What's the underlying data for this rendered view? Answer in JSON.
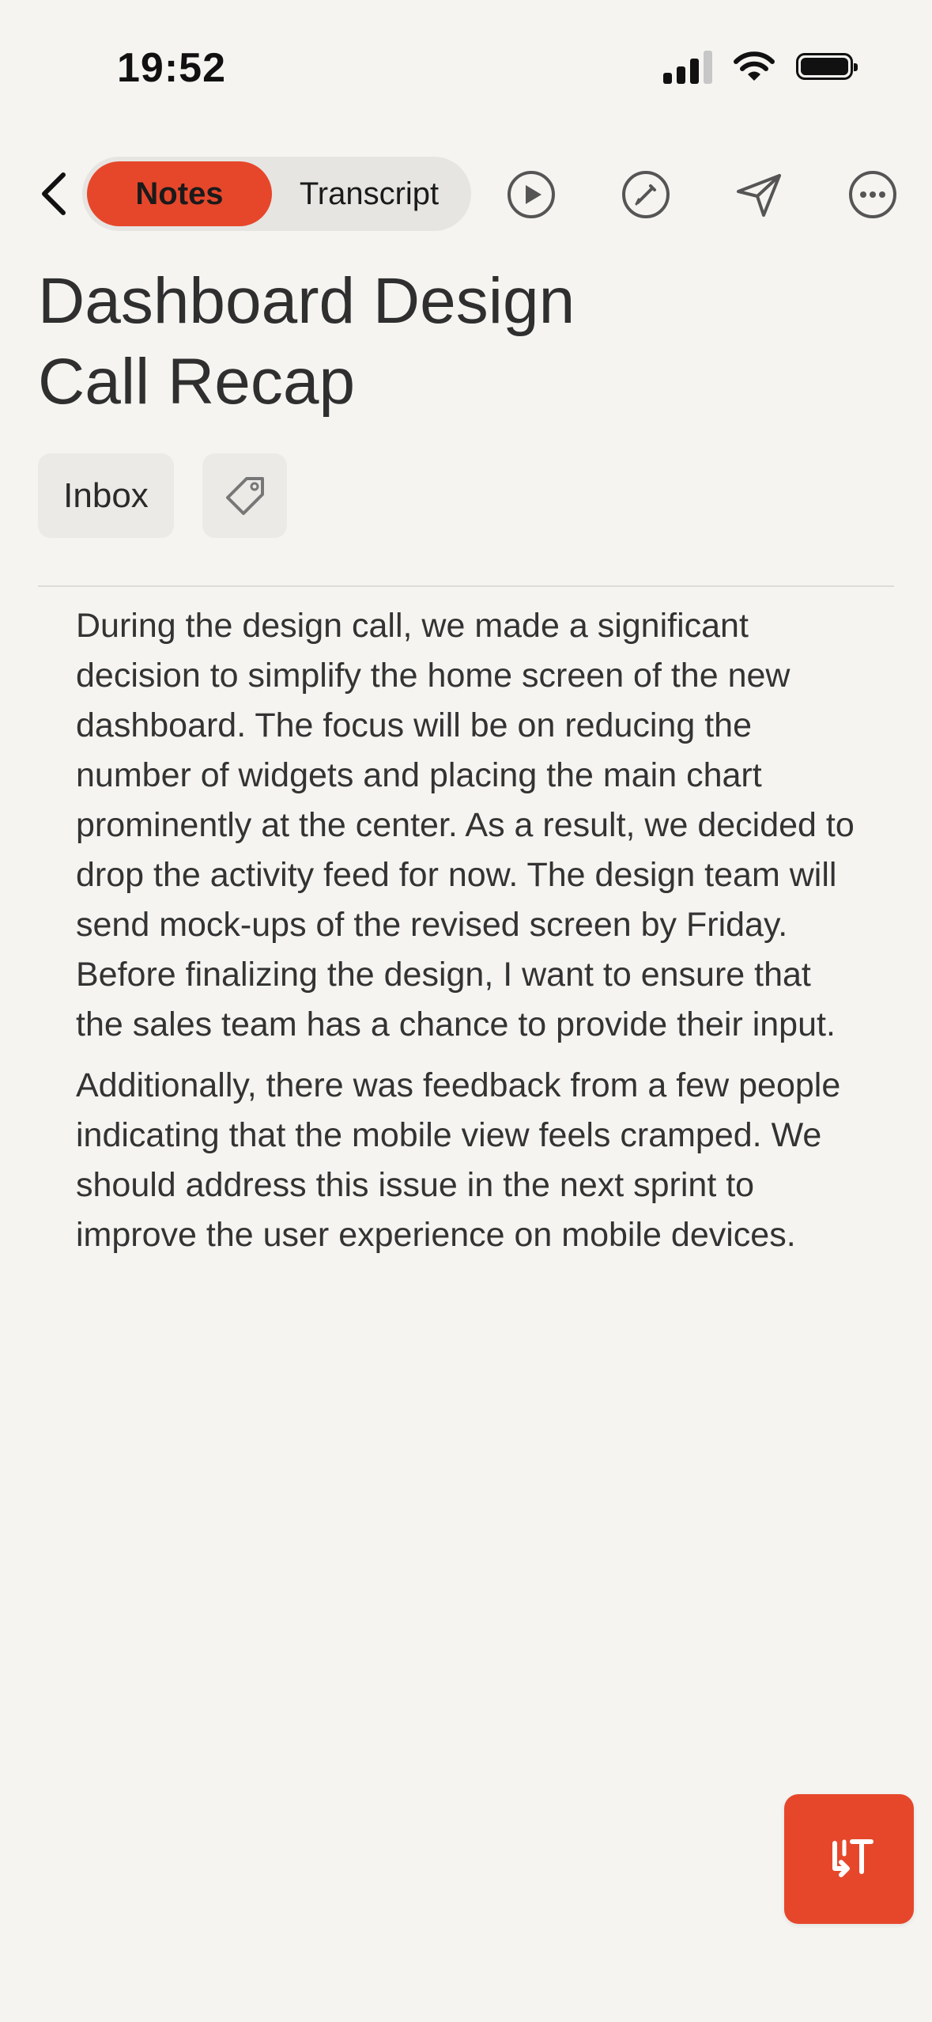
{
  "status_bar": {
    "time": "19:52",
    "icons": [
      "cellular-signal-icon",
      "wifi-icon",
      "battery-icon"
    ]
  },
  "toolbar": {
    "back_icon": "chevron-left-icon",
    "tabs": [
      {
        "label": "Notes",
        "active": true
      },
      {
        "label": "Transcript",
        "active": false
      }
    ],
    "actions": [
      "play-icon",
      "edit-icon",
      "send-icon",
      "more-icon"
    ]
  },
  "note": {
    "title_line1": "Dashboard Design",
    "title_line2": "Call Recap",
    "folder": "Inbox",
    "tag_icon": "tag-icon",
    "paragraphs": [
      "During the design call, we made a significant decision to simplify the home screen of the new dashboard. The focus will be on reducing the number of widgets and placing the main chart prominently at the center. As a result, we decided to drop the activity feed for now. The design team will send mock-ups of the revised screen by Friday. Before finalizing the design, I want to ensure that the sales team has a chance to provide their input.",
      "Additionally, there was feedback from a few people indicating that the mobile view feels cramped. We should address this issue in the next sprint to improve the user experience on mobile devices."
    ]
  },
  "fab": {
    "icon": "transcribe-icon"
  },
  "colors": {
    "accent": "#e6472b",
    "background": "#f5f4f1",
    "chip_background": "#ebeae6",
    "segmented_background": "#e6e5e2"
  }
}
